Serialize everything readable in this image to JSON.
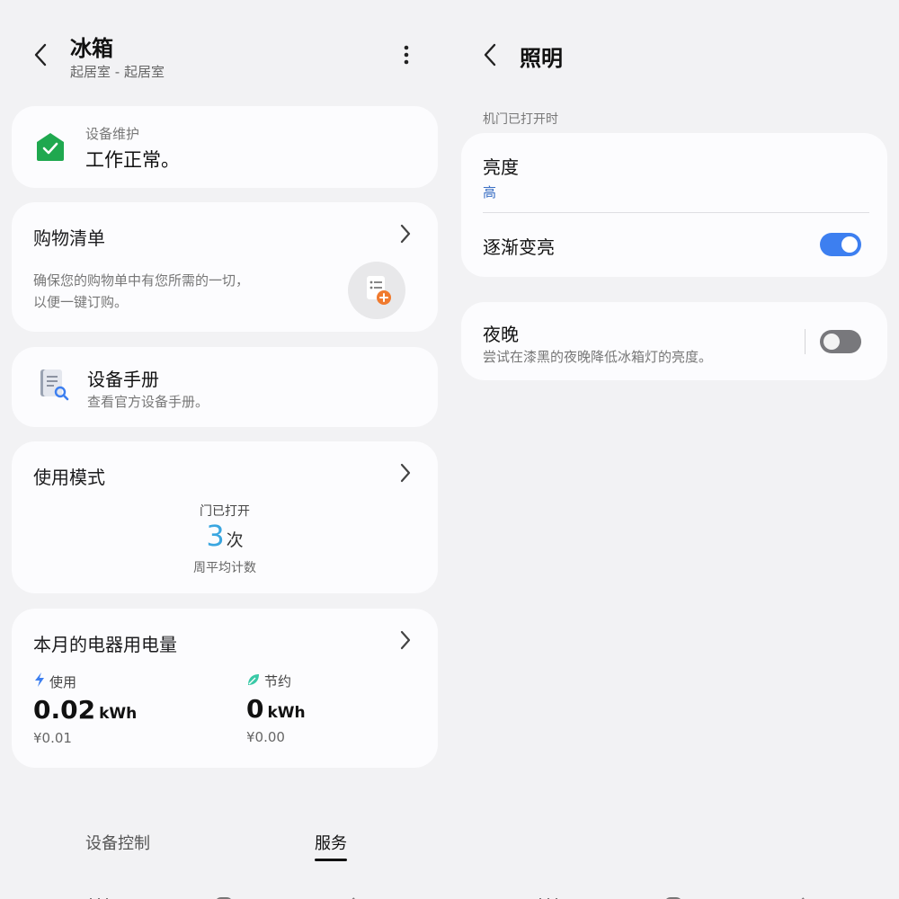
{
  "left": {
    "header": {
      "title": "冰箱",
      "subtitle": "起居室 - 起居室"
    },
    "maintenance": {
      "label": "设备维护",
      "status": "工作正常。"
    },
    "shopping": {
      "title": "购物清单",
      "desc_line1": "确保您的购物单中有您所需的一切，",
      "desc_line2": "以便一键订购。"
    },
    "manual": {
      "title": "设备手册",
      "desc": "查看官方设备手册。"
    },
    "usage": {
      "title": "使用模式",
      "caption": "门已打开",
      "count": "3",
      "count_unit": "次",
      "footer": "周平均计数"
    },
    "energy": {
      "title": "本月的电器用电量",
      "used": {
        "label": "使用",
        "value": "0.02",
        "unit": "kWh",
        "cost": "¥0.01"
      },
      "saved": {
        "label": "节约",
        "value": "0",
        "unit": "kWh",
        "cost": "¥0.00"
      }
    },
    "tabs": [
      {
        "label": "设备控制",
        "active": false
      },
      {
        "label": "服务",
        "active": true
      }
    ]
  },
  "right": {
    "header": {
      "title": "照明"
    },
    "section_label": "机门已打开时",
    "brightness": {
      "label": "亮度",
      "value": "高"
    },
    "gradual": {
      "label": "逐渐变亮",
      "enabled": true
    },
    "night": {
      "label": "夜晚",
      "desc": "尝试在漆黑的夜晚降低冰箱灯的亮度。",
      "enabled": false
    }
  },
  "colors": {
    "accent": "#3d7ff0",
    "count": "#3aa6e0",
    "maintenance_green": "#1fa84f",
    "brightness_value": "#3a6fc4"
  }
}
